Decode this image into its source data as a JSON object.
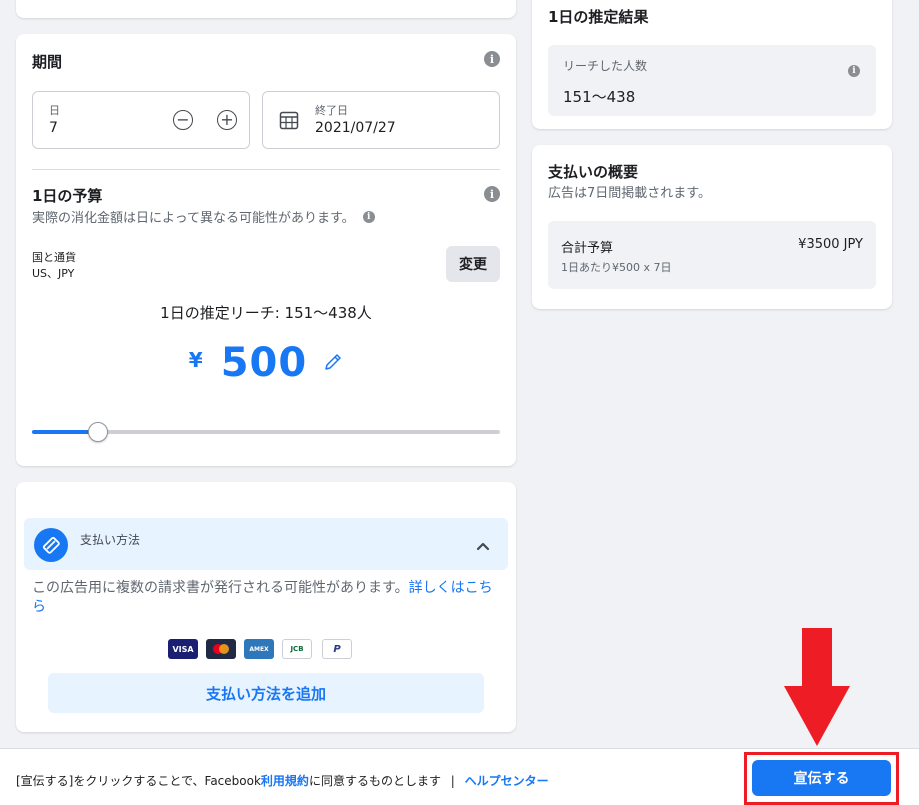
{
  "period": {
    "title": "期間",
    "days_label": "日",
    "days_value": "7",
    "minus_label": "−",
    "plus_label": "+",
    "end_label": "終了日",
    "end_value": "2021/07/27"
  },
  "budget": {
    "title": "1日の予算",
    "note": "実際の消化金額は日によって異なる可能性があります。",
    "country_label": "国と通貨",
    "country_value": "US、JPY",
    "change_button": "変更",
    "reach_text": "1日の推定リーチ: 151〜438人",
    "currency_symbol": "¥",
    "amount": "500",
    "slider_fraction": 0.14
  },
  "payment": {
    "method_label": "支払い方法",
    "notice": "この広告用に複数の請求書が発行される可能性があります。",
    "learn_more": "詳しくはこちら",
    "cards": [
      "VISA",
      "MC",
      "AMEX",
      "JCB",
      "P"
    ],
    "add_button": "支払い方法を追加"
  },
  "estimate": {
    "title": "1日の推定結果",
    "reach_label": "リーチした人数",
    "reach_value": "151〜438"
  },
  "summary": {
    "title": "支払いの概要",
    "subtitle": "広告は7日間掲載されます。",
    "total_label": "合計予算",
    "total_value": "¥3500 JPY",
    "breakdown": "1日あたり¥500 x 7日"
  },
  "footer": {
    "agree_prefix": "[宣伝する]をクリックすることで、Facebook",
    "terms_link": "利用規約",
    "agree_suffix": "に同意するものとします",
    "separator": "|",
    "help_link": "ヘルプセンター",
    "promote_button": "宣伝する"
  },
  "colors": {
    "accent": "#1877f2",
    "highlight": "#ee1c25"
  }
}
